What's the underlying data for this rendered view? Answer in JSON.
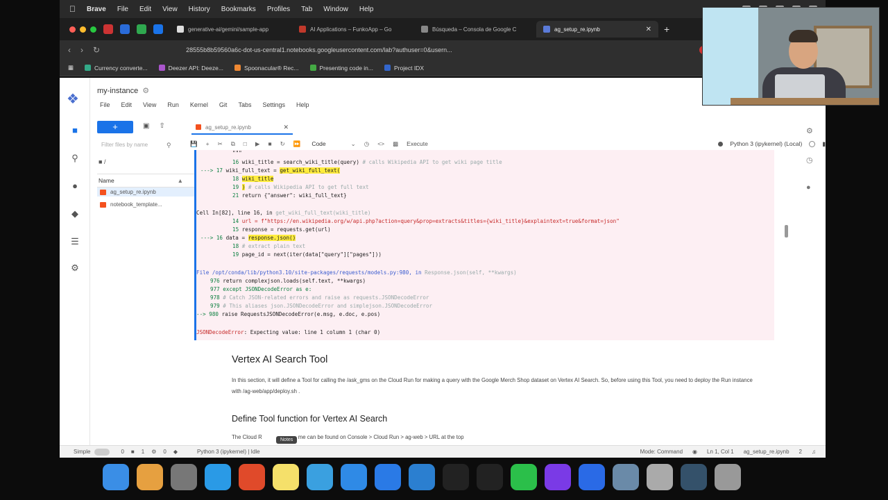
{
  "menubar": {
    "app": "Brave",
    "items": [
      "File",
      "Edit",
      "View",
      "History",
      "Bookmarks",
      "Profiles",
      "Tab",
      "Window",
      "Help"
    ]
  },
  "browser": {
    "tabs": [
      {
        "label": "generative-ai/gemini/sample-app"
      },
      {
        "label": "AI Applications – FunkoApp – Go"
      },
      {
        "label": "Búsqueda – Consola de Google C"
      },
      {
        "label": "ag_setup_re.ipynb",
        "active": true
      }
    ],
    "url": "28555b8b59560a6c-dot-us-central1.notebooks.googleusercontent.com/lab?authuser=0&usern...",
    "bookmarks": [
      "Currency converte...",
      "Deezer API: Deeze...",
      "Spoonacular® Rec...",
      "Presenting code in...",
      "Project IDX"
    ]
  },
  "jupyter": {
    "instance_title": "my-instance",
    "menu": [
      "File",
      "Edit",
      "View",
      "Run",
      "Kernel",
      "Git",
      "Tabs",
      "Settings",
      "Help"
    ],
    "new_button": "+",
    "filter_placeholder": "Filter files by name",
    "breadcrumb": "/",
    "files_column": "Name",
    "files": [
      {
        "name": "ag_setup_re.ipynb",
        "selected": true
      },
      {
        "name": "notebook_template..."
      }
    ],
    "doc_tab": "ag_setup_re.ipynb",
    "cell_type": "Code",
    "execute_label": "Execute",
    "kernel_name": "Python 3 (ipykernel) (Local)"
  },
  "traceback": {
    "lines": [
      {
        "n": "16",
        "code": "wiki_title = search_wiki_title(query)",
        "comment": "# calls Wikipedia API to get wiki page title"
      },
      {
        "arrow": "---> 17",
        "code": "wiki_full_text = ",
        "hl": "get_wiki_full_text("
      },
      {
        "n": "18",
        "hl": "    wiki_title"
      },
      {
        "n": "19",
        "code": ")",
        "comment": "# calls Wikipedia API to get full text"
      },
      {
        "n": "21",
        "code": "return {\"answer\": wiki_full_text}"
      },
      {
        "cell": "Cell In[82], line 16, in ",
        "fn": "get_wiki_full_text(wiki_title)"
      },
      {
        "n": "14",
        "code": "url = f\"https://en.wikipedia.org/w/api.php?action=query&prop=extracts&titles={wiki_title}&explaintext=true&format=json\""
      },
      {
        "n": "15",
        "code": "response = requests.get(url)"
      },
      {
        "arrow": "---> 16",
        "code": "data = ",
        "hl": "response.json()"
      },
      {
        "n": "18",
        "comment": "# extract plain text"
      },
      {
        "n": "19",
        "code": "page_id = next(iter(data[\"query\"][\"pages\"]))"
      },
      {
        "file": "File /opt/conda/lib/python3.10/site-packages/requests/models.py:980, in ",
        "fn": "Response.json(self, **kwargs)"
      },
      {
        "n": "976",
        "code": "    return complexjson.loads(self.text, **kwargs)"
      },
      {
        "n": "977",
        "code": "except JSONDecodeError as e:"
      },
      {
        "n": "978",
        "comment": "    # Catch JSON-related errors and raise as requests.JSONDecodeError"
      },
      {
        "n": "979",
        "comment": "    # This aliases json.JSONDecodeError and simplejson.JSONDecodeError"
      },
      {
        "arrow": "--> 980",
        "code": "    raise RequestsJSONDecodeError(e.msg, e.doc, e.pos)"
      },
      {
        "error": "JSONDecodeError",
        "msg": ": Expecting value: line 1 column 1 (char 0)"
      }
    ]
  },
  "markdown": {
    "h1": "Vertex AI Search Tool",
    "p1": "In this section, it will define a Tool for calling the /ask_gms on the Cloud Run for making a query with the Google Merch Shop dataset on Vertex AI Search. So, before using this Tool, you need to deploy the Run instance with /ag-web/app/deploy.sh .",
    "h2": "Define Tool function for Vertex AI Search",
    "p2_start": "The Cloud R",
    "p2_end": "me can be found on Console > Cloud Run > ag-web > URL at the top",
    "tooltip": "Notes"
  },
  "statusbar": {
    "mode_label": "Simple",
    "counts": [
      "0",
      "1",
      "0"
    ],
    "kernel": "Python 3 (ipykernel) | Idle",
    "mode": "Mode: Command",
    "position": "Ln 1, Col 1",
    "filename": "ag_setup_re.ipynb",
    "notif": "2"
  },
  "colors": {
    "accent": "#1a73e8",
    "error_bg": "#fdeff3",
    "highlight": "#ffec3d"
  }
}
